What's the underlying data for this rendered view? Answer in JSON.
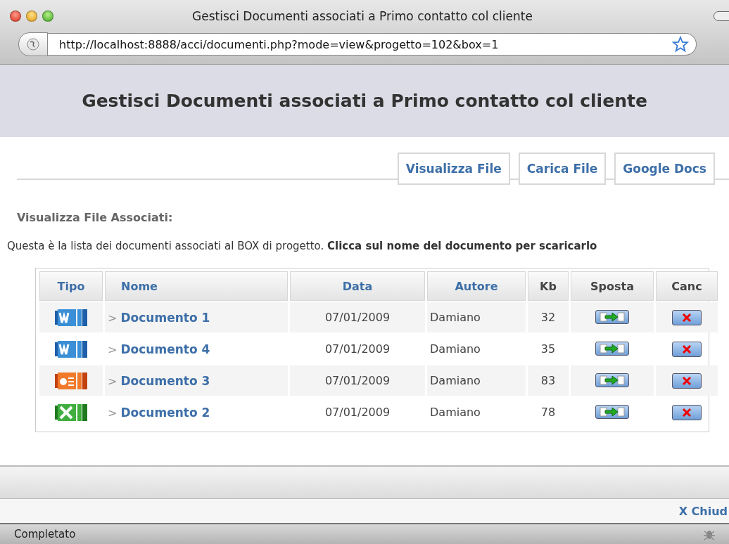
{
  "window": {
    "title": "Gestisci Documenti associati a Primo contatto col cliente",
    "url": "http://localhost:8888/acci/documenti.php?mode=view&progetto=102&box=1"
  },
  "header": {
    "title": "Gestisci Documenti associati a Primo contatto col cliente"
  },
  "tabs": [
    {
      "label": "Visualizza File"
    },
    {
      "label": "Carica File"
    },
    {
      "label": "Google Docs"
    }
  ],
  "section_title": "Visualizza File Associati:",
  "description": "Questa è la lista dei documenti associati al BOX di progetto. **Clicca sul nome del documento per scaricarlo**",
  "table": {
    "columns": [
      {
        "label": "Tipo",
        "sortable": true
      },
      {
        "label": "Nome",
        "sortable": true
      },
      {
        "label": "Data",
        "sortable": true
      },
      {
        "label": "Autore",
        "sortable": true
      },
      {
        "label": "Kb",
        "sortable": false
      },
      {
        "label": "Sposta",
        "sortable": false
      },
      {
        "label": "Canc",
        "sortable": false
      }
    ],
    "rows": [
      {
        "kind": "word",
        "marker": ">",
        "name": "Documento 1",
        "date": "07/01/2009",
        "author": "Damiano",
        "kb": "32"
      },
      {
        "kind": "word",
        "marker": ">",
        "name": "Documento 4",
        "date": "07/01/2009",
        "author": "Damiano",
        "kb": "35"
      },
      {
        "kind": "powerpoint",
        "marker": ">",
        "name": "Documento 3",
        "date": "07/01/2009",
        "author": "Damiano",
        "kb": "83"
      },
      {
        "kind": "excel",
        "marker": ">",
        "name": "Documento 2",
        "date": "07/01/2009",
        "author": "Damiano",
        "kb": "78"
      }
    ]
  },
  "close_link": "X Chiud",
  "status_bar": "Completato"
}
